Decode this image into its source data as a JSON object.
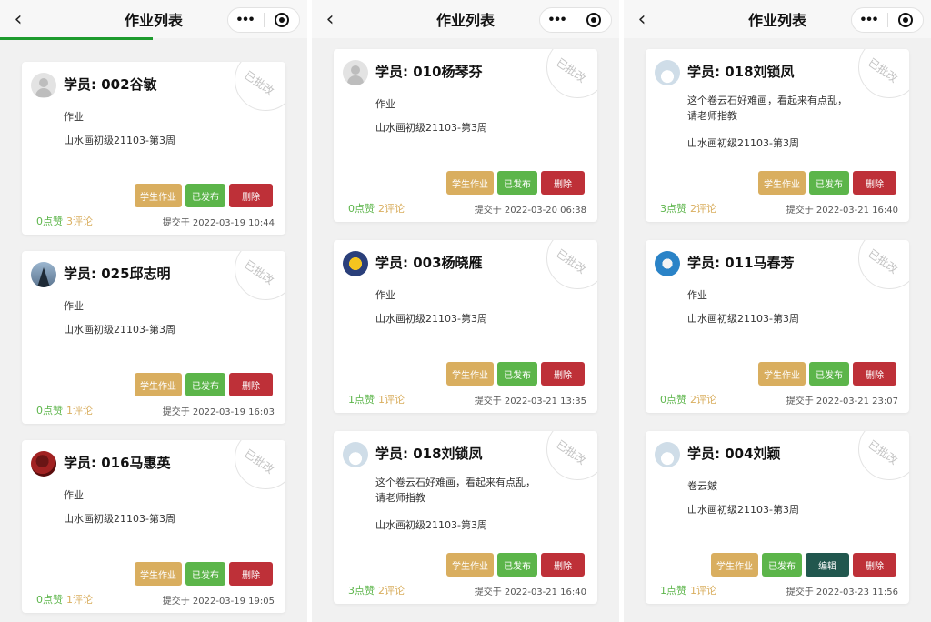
{
  "screens": [
    {
      "title": "作业列表",
      "cards": [
        {
          "avatar": "default",
          "student": "学员: 002谷敏",
          "desc": [
            "作业",
            "山水画初级21103-第3周"
          ],
          "stamp": "已批改",
          "buttons": [
            "学生作业",
            "已发布",
            "删除"
          ],
          "likes": "0点赞",
          "comments": "3评论",
          "submitted": "提交于 2022-03-19 10:44"
        },
        {
          "avatar": "tower",
          "student": "学员: 025邱志明",
          "desc": [
            "作业",
            "山水画初级21103-第3周"
          ],
          "stamp": "已批改",
          "buttons": [
            "学生作业",
            "已发布",
            "删除"
          ],
          "likes": "0点赞",
          "comments": "1评论",
          "submitted": "提交于 2022-03-19 16:03"
        },
        {
          "avatar": "flower",
          "student": "学员: 016马惠英",
          "desc": [
            "作业",
            "山水画初级21103-第3周"
          ],
          "stamp": "已批改",
          "buttons": [
            "学生作业",
            "已发布",
            "删除"
          ],
          "likes": "0点赞",
          "comments": "1评论",
          "submitted": "提交于 2022-03-19 19:05"
        }
      ]
    },
    {
      "title": "作业列表",
      "cards": [
        {
          "avatar": "default",
          "student": "学员: 010杨琴芬",
          "desc": [
            "作业",
            "山水画初级21103-第3周"
          ],
          "stamp": "已批改",
          "buttons": [
            "学生作业",
            "已发布",
            "删除"
          ],
          "likes": "0点赞",
          "comments": "2评论",
          "submitted": "提交于 2022-03-20 06:38"
        },
        {
          "avatar": "sun",
          "student": "学员: 003杨晓雁",
          "desc": [
            "作业",
            "山水画初级21103-第3周"
          ],
          "stamp": "已批改",
          "buttons": [
            "学生作业",
            "已发布",
            "删除"
          ],
          "likes": "1点赞",
          "comments": "1评论",
          "submitted": "提交于 2022-03-21 13:35"
        },
        {
          "avatar": "cloud",
          "student": "学员: 018刘锁凤",
          "desc": [
            "这个卷云石好难画，看起来有点乱，",
            "请老师指教",
            "山水画初级21103-第3周"
          ],
          "stamp": "已批改",
          "buttons": [
            "学生作业",
            "已发布",
            "删除"
          ],
          "likes": "3点赞",
          "comments": "2评论",
          "submitted": "提交于 2022-03-21 16:40"
        }
      ]
    },
    {
      "title": "作业列表",
      "cards": [
        {
          "avatar": "cloud",
          "student": "学员: 018刘锁凤",
          "desc": [
            "这个卷云石好难画，看起来有点乱，",
            "请老师指教",
            "山水画初级21103-第3周"
          ],
          "stamp": "已批改",
          "buttons": [
            "学生作业",
            "已发布",
            "删除"
          ],
          "likes": "3点赞",
          "comments": "2评论",
          "submitted": "提交于 2022-03-21 16:40"
        },
        {
          "avatar": "blue",
          "student": "学员: 011马春芳",
          "desc": [
            "作业",
            "山水画初级21103-第3周"
          ],
          "stamp": "已批改",
          "buttons": [
            "学生作业",
            "已发布",
            "删除"
          ],
          "likes": "0点赞",
          "comments": "2评论",
          "submitted": "提交于 2022-03-21 23:07"
        },
        {
          "avatar": "cloud",
          "student": "学员: 004刘颖",
          "desc": [
            "卷云皴",
            "山水画初级21103-第3周"
          ],
          "stamp": "已批改",
          "buttons": [
            "学生作业",
            "已发布",
            "编辑",
            "删除"
          ],
          "likes": "1点赞",
          "comments": "1评论",
          "submitted": "提交于 2022-03-23 11:56"
        }
      ]
    }
  ]
}
